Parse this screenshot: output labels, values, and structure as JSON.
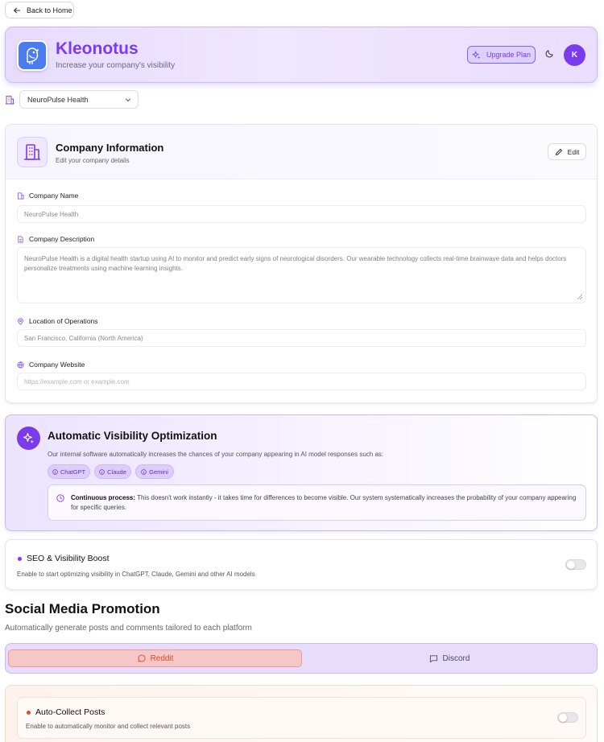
{
  "nav": {
    "back_label": "Back to Home"
  },
  "header": {
    "app_name": "Kleonotus",
    "tagline": "Increase your company's visibility",
    "upgrade_label": "Upgrade Plan",
    "avatar_initial": "K"
  },
  "company_selector": {
    "selected": "NeuroPulse Health"
  },
  "company_info": {
    "title": "Company Information",
    "subtitle": "Edit your company details",
    "edit_label": "Edit",
    "fields": {
      "name": {
        "label": "Company Name",
        "value": "NeuroPulse Health"
      },
      "description": {
        "label": "Company Description",
        "value": "NeuroPulse Health is a digital health startup using AI to monitor and predict early signs of neurological disorders. Our wearable technology collects real-time brainwave data and helps doctors personalize treatments using machine learning insights."
      },
      "location": {
        "label": "Location of Operations",
        "value": "San Francisco, California (North America)"
      },
      "website": {
        "label": "Company Website",
        "placeholder": "https://example.com or example.com"
      }
    }
  },
  "optimization": {
    "title": "Automatic Visibility Optimization",
    "description": "Our internal software automatically increases the chances of your company appearing in AI model responses such as:",
    "models": [
      "ChatGPT",
      "Claude",
      "Gemini"
    ],
    "notice_bold": "Continuous process:",
    "notice_text": " This doesn't work instantly - it takes time for differences to become visible. Our system systematically increases the probability of your company appearing for specific queries."
  },
  "seo": {
    "title": "SEO & Visibility Boost",
    "description": "Enable to start optimizing visibility in ChatGPT, Claude, Gemini and other AI models",
    "enabled": false
  },
  "social": {
    "title": "Social Media Promotion",
    "subtitle": "Automatically generate posts and comments tailored to each platform",
    "tabs": [
      "Reddit",
      "Discord"
    ],
    "active_tab": "Reddit",
    "auto_collect": {
      "title": "Auto-Collect Posts",
      "description": "Enable to automatically monitor and collect relevant posts",
      "enabled": false
    }
  },
  "colors": {
    "accent": "#7c3aed",
    "reddit": "#e24b26",
    "logo_bg": "#4a7bf0"
  }
}
